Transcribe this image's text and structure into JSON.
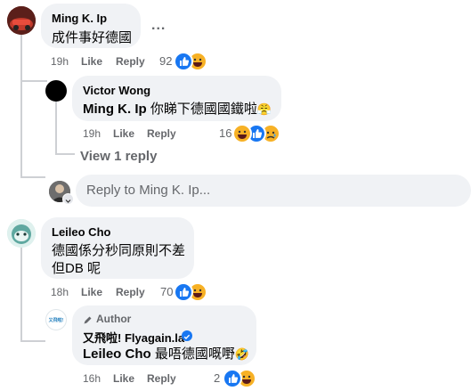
{
  "comments": [
    {
      "author": "Ming K. Ip",
      "text": "成件事好德國",
      "time": "19h",
      "like": "Like",
      "reply": "Reply",
      "reaction_count": "92",
      "more": "..."
    },
    {
      "author": "Victor Wong",
      "tag": "Ming K. Ip",
      "text": " 你睇下德國國鐵啦",
      "emoji": "😤",
      "time": "19h",
      "like": "Like",
      "reply": "Reply",
      "reaction_count": "16"
    },
    {
      "author": "Leileo Cho",
      "text_line1": "德國係分秒同原則不差",
      "text_line2": "但DB 呢",
      "time": "18h",
      "like": "Like",
      "reply": "Reply",
      "reaction_count": "70"
    },
    {
      "badge": "Author",
      "author": "又飛啦! Flyagain.la",
      "tag": "Leileo Cho",
      "text": " 最唔德國嘅嘢",
      "emoji": "🤣",
      "time": "16h",
      "like": "Like",
      "reply": "Reply",
      "reaction_count": "2",
      "avatar_text": "又飛啦!"
    }
  ],
  "view_replies": "View 1 reply",
  "reply_placeholder": "Reply to Ming K. Ip...",
  "colors": {
    "like_blue": "#1877f2",
    "meta_gray": "#65676b",
    "bubble": "#f0f2f5"
  }
}
